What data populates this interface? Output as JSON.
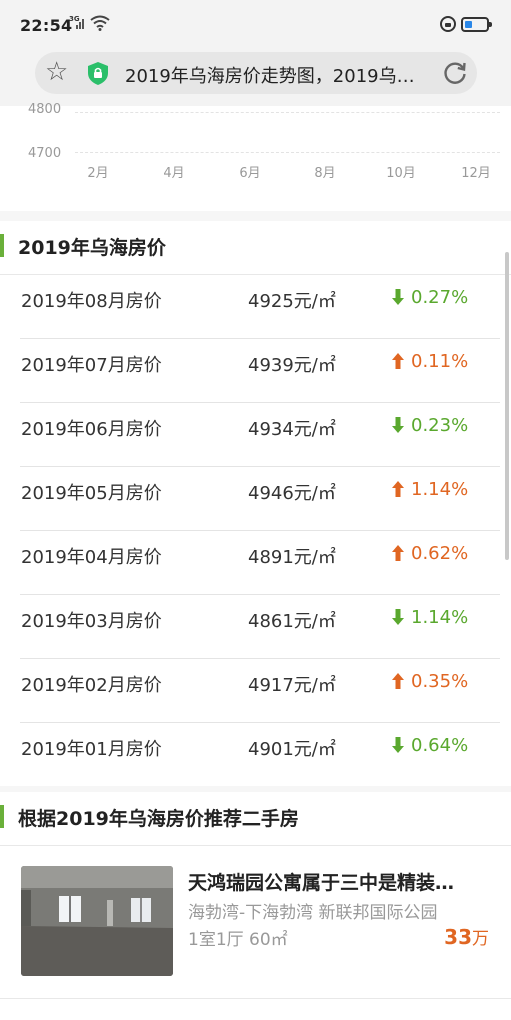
{
  "status_bar": {
    "time": "22:54",
    "network": "3G",
    "battery_level": 0.35
  },
  "browser": {
    "star_icon": "star-outline-icon",
    "security_icon": "green-shield-lock-icon",
    "url_text": "2019年乌海房价走势图，2019乌…",
    "reload_icon": "reload-icon"
  },
  "chart_data": {
    "type": "line",
    "y_ticks": [
      "4800",
      "4700"
    ],
    "x_ticks": [
      "2月",
      "4月",
      "6月",
      "8月",
      "10月",
      "12月"
    ]
  },
  "price_section": {
    "title": "2019年乌海房价",
    "rows": [
      {
        "month": "2019年08月房价",
        "price": "4925元/㎡",
        "direction": "down",
        "change": "0.27%"
      },
      {
        "month": "2019年07月房价",
        "price": "4939元/㎡",
        "direction": "up",
        "change": "0.11%"
      },
      {
        "month": "2019年06月房价",
        "price": "4934元/㎡",
        "direction": "down",
        "change": "0.23%"
      },
      {
        "month": "2019年05月房价",
        "price": "4946元/㎡",
        "direction": "up",
        "change": "1.14%"
      },
      {
        "month": "2019年04月房价",
        "price": "4891元/㎡",
        "direction": "up",
        "change": "0.62%"
      },
      {
        "month": "2019年03月房价",
        "price": "4861元/㎡",
        "direction": "down",
        "change": "1.14%"
      },
      {
        "month": "2019年02月房价",
        "price": "4917元/㎡",
        "direction": "up",
        "change": "0.35%"
      },
      {
        "month": "2019年01月房价",
        "price": "4901元/㎡",
        "direction": "down",
        "change": "0.64%"
      }
    ]
  },
  "recommend_section": {
    "title": "根据2019年乌海房价推荐二手房",
    "listing": {
      "title": "天鸿瑞园公寓属于三中是精装…",
      "location": "海勃湾-下海勃湾 新联邦国际公园",
      "spec": "1室1厅 60㎡",
      "price": "33",
      "price_unit": "万"
    }
  },
  "colors": {
    "down": "#5aa82e",
    "up": "#e06622",
    "section_accent": "#6ab03a",
    "shield": "#2bbf6a"
  }
}
